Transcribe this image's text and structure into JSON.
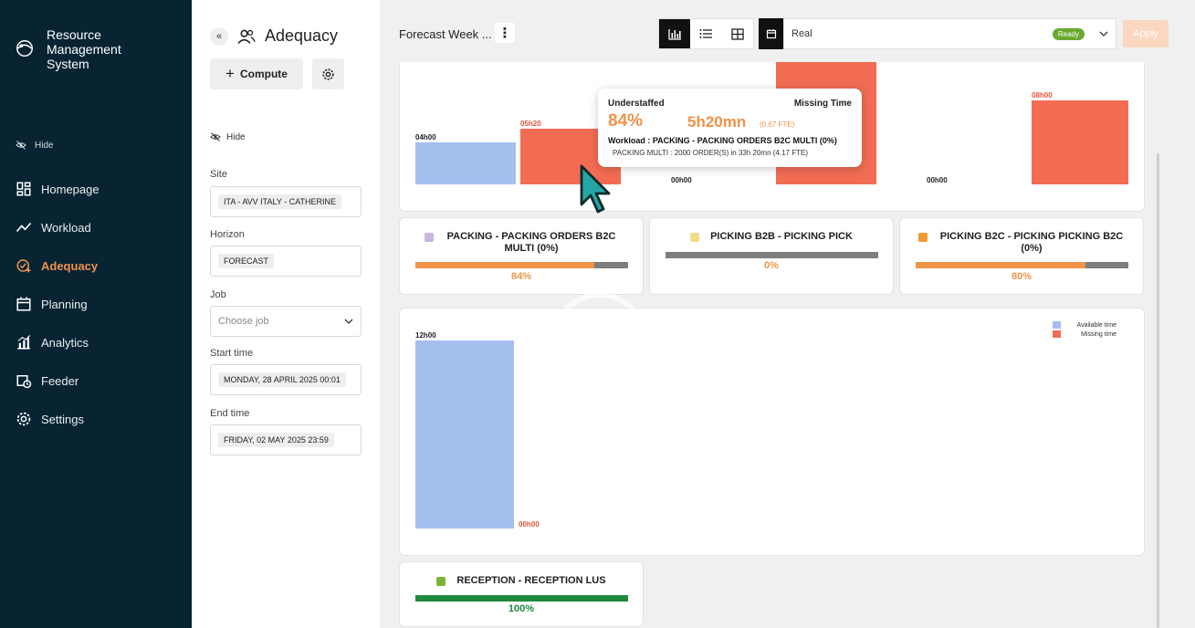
{
  "brand": {
    "lines": [
      "Resource",
      "Management",
      "System"
    ]
  },
  "sidebar": {
    "hide_label": "Hide",
    "items": [
      {
        "label": "Homepage",
        "icon": "dashboard-icon"
      },
      {
        "label": "Workload",
        "icon": "trend-icon"
      },
      {
        "label": "Adequacy",
        "icon": "adequacy-icon",
        "active": true
      },
      {
        "label": "Planning",
        "icon": "calendar-icon"
      },
      {
        "label": "Analytics",
        "icon": "analytics-icon"
      },
      {
        "label": "Feeder",
        "icon": "feeder-icon"
      },
      {
        "label": "Settings",
        "icon": "gear-icon"
      }
    ]
  },
  "panel": {
    "title": "Adequacy",
    "compute_label": "Compute",
    "hide_label": "Hide",
    "site_label": "Site",
    "site_value": "ITA - AVV ITALY - CATHERINE",
    "horizon_label": "Horizon",
    "horizon_value": "FORECAST",
    "job_label": "Job",
    "job_placeholder": "Choose job",
    "start_label": "Start time",
    "start_value": "MONDAY, 28 APRIL 2025 00:01",
    "end_label": "End time",
    "end_value": "FRIDAY, 02 MAY 2025 23:59"
  },
  "toolbar": {
    "title": "Forecast Week ...",
    "kebab": "⋮",
    "scenario": "Real",
    "status": "Ready",
    "apply_label": "Apply"
  },
  "colors": {
    "available": "#a4bfee",
    "missing": "#f26c54",
    "accent": "#f0924a",
    "success": "#1f8a3e",
    "sidebar_bg": "#082433"
  },
  "top_chart": {
    "groups": [
      {
        "available_label": "04h00",
        "missing_label": "05h20"
      },
      {
        "available_label": "",
        "missing_label": "00h00"
      },
      {
        "available_label": "",
        "missing_label": ""
      },
      {
        "available_label": "00h00",
        "missing_label": "08h00"
      }
    ]
  },
  "tooltip": {
    "understaffed_label": "Understaffed",
    "missing_label": "Missing Time",
    "pct": "84%",
    "missing_value": "5h20mn",
    "fte": "(0.67 FTE)",
    "workload": "Workload : PACKING - PACKING ORDERS B2C MULTI (0%)",
    "detail": "PACKING MULTI : 2000 ORDER(S) in 33h 20mn (4.17 FTE)"
  },
  "jobs": [
    {
      "title": "PACKING - PACKING ORDERS B2C MULTI (0%)",
      "dot": "#c9b6e0",
      "fill": 0.84,
      "fill_color": "#ef9548",
      "pct": "84%",
      "pct_color": "#ef9548"
    },
    {
      "title": "PICKING B2B - PICKING PICK",
      "dot": "#f4dc8a",
      "fill": 0,
      "fill_color": "#ef9548",
      "pct": "0%",
      "pct_color": "#ef9548"
    },
    {
      "title": "PICKING B2C - PICKING PICKING B2C (0%)",
      "dot": "#ef9a30",
      "fill": 0.8,
      "fill_color": "#ef9548",
      "pct": "80%",
      "pct_color": "#ef9548"
    }
  ],
  "mid_chart": {
    "legend": [
      "Available time",
      "Missing time"
    ],
    "available_label": "12h00",
    "missing_label": "00h00",
    "available_value": 12,
    "missing_value": 0
  },
  "reception": {
    "title": "RECEPTION - RECEPTION LUS",
    "dot": "#7ab53a",
    "fill": 1,
    "pct": "100%"
  }
}
